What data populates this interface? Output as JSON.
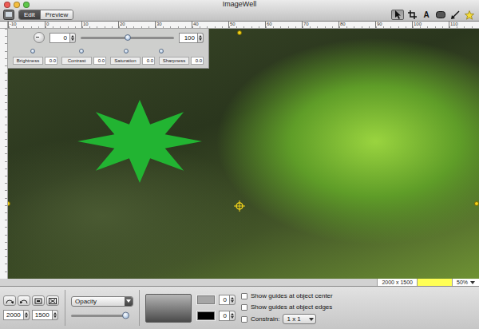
{
  "window": {
    "title": "ImageWell"
  },
  "mode_tabs": [
    {
      "label": "Edit",
      "selected": true
    },
    {
      "label": "Preview",
      "selected": false
    }
  ],
  "tools": [
    {
      "kind": "arrow",
      "selected": true
    },
    {
      "kind": "crop",
      "selected": false
    },
    {
      "kind": "text",
      "label": "A",
      "selected": false
    },
    {
      "kind": "shape",
      "selected": false
    },
    {
      "kind": "pen",
      "selected": false
    },
    {
      "kind": "star",
      "selected": false
    }
  ],
  "ruler": {
    "labels": [
      "-10",
      "0",
      "10",
      "20",
      "30",
      "40",
      "50",
      "60",
      "70",
      "80",
      "90",
      "100",
      "110"
    ]
  },
  "adjust_panel": {
    "rotation": {
      "value": "0"
    },
    "scale": {
      "value": "100",
      "level": 0.5
    },
    "sliders": [
      {
        "label": "Brightness",
        "value": "0.0",
        "level": 0.45
      },
      {
        "label": "Contrast",
        "value": "0.0",
        "level": 0.45
      },
      {
        "label": "Saturation",
        "value": "0.0",
        "level": 0.35
      },
      {
        "label": "Sharpness",
        "value": "0.0",
        "level": 0.05
      }
    ]
  },
  "shape": {
    "kind": "star",
    "color": "#22b432"
  },
  "status": {
    "size": "2000 x 1500",
    "zoom": "50%"
  },
  "bottom": {
    "width": "2000",
    "height": "1500",
    "blend_mode": "Opacity",
    "opacity_level": 0.95,
    "color_wells": [
      {
        "color": "#a6a6a6",
        "value": "0"
      },
      {
        "color": "#000000",
        "value": "0"
      }
    ],
    "options": [
      {
        "label": "Show guides at object center",
        "checked": false
      },
      {
        "label": "Show guides at object edges",
        "checked": false
      }
    ],
    "constrain": {
      "label": "Constrain:",
      "checked": false,
      "value": "1 x 1"
    }
  }
}
